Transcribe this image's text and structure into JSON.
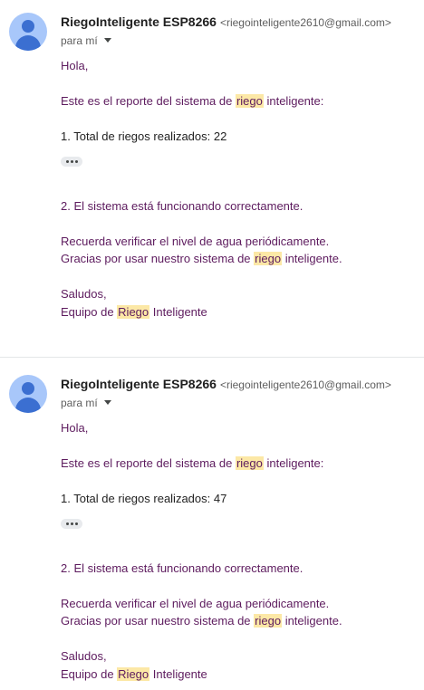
{
  "messages": [
    {
      "sender_name": "RiegoInteligente ESP8266",
      "sender_email": "<riegointeligente2610@gmail.com>",
      "recipient": "para mí",
      "greeting": "Hola,",
      "report_intro_before": "Este es el reporte del sistema de ",
      "report_intro_highlight": "riego",
      "report_intro_after": " inteligente:",
      "total_irrigations": "1. Total de riegos realizados: 22",
      "system_status": "2. El sistema está funcionando correctamente.",
      "reminder": "Recuerda verificar el nivel de agua periódicamente.",
      "thanks_before": "Gracias por usar nuestro sistema de ",
      "thanks_highlight": "riego",
      "thanks_after": " inteligente.",
      "closing": "Saludos,",
      "signature_before": "Equipo de ",
      "signature_highlight": "Riego",
      "signature_after": " Inteligente"
    },
    {
      "sender_name": "RiegoInteligente ESP8266",
      "sender_email": "<riegointeligente2610@gmail.com>",
      "recipient": "para mí",
      "greeting": "Hola,",
      "report_intro_before": "Este es el reporte del sistema de ",
      "report_intro_highlight": "riego",
      "report_intro_after": " inteligente:",
      "total_irrigations": "1. Total de riegos realizados: 47",
      "system_status": "2. El sistema está funcionando correctamente.",
      "reminder": "Recuerda verificar el nivel de agua periódicamente.",
      "thanks_before": "Gracias por usar nuestro sistema de ",
      "thanks_highlight": "riego",
      "thanks_after": " inteligente.",
      "closing": "Saludos,",
      "signature_before": "Equipo de ",
      "signature_highlight": "Riego",
      "signature_after": " Inteligente"
    }
  ],
  "icons": {
    "avatar": "person-avatar-icon",
    "recipient_details": "chevron-down-icon",
    "trimmed_content": "more-horiz-icon"
  },
  "colors": {
    "body_text_purple": "#5d1b5e",
    "highlight": "#fce8a6",
    "avatar_bg": "#a8c7fa",
    "avatar_fg": "#3b6fd1"
  }
}
